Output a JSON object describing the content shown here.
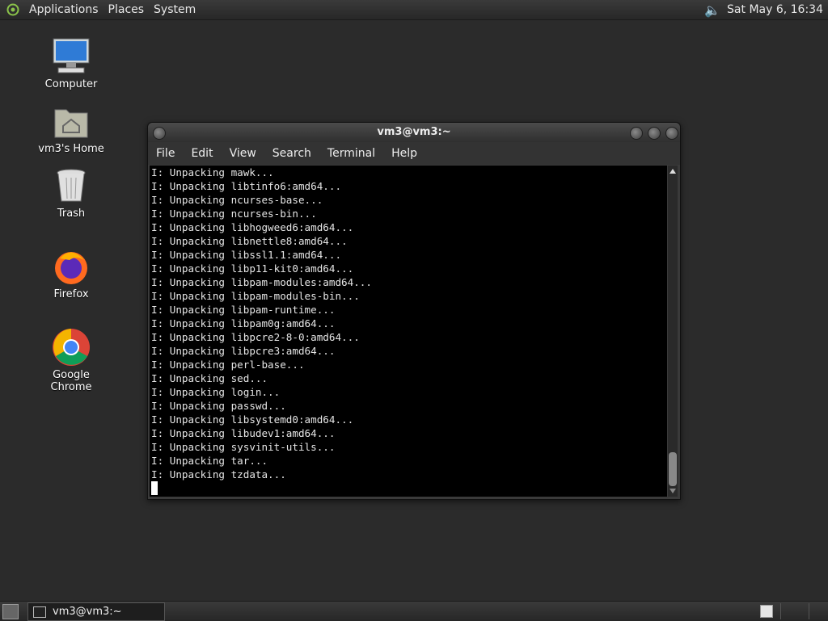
{
  "top_panel": {
    "menus": [
      "Applications",
      "Places",
      "System"
    ],
    "clock": "Sat May  6, 16:34"
  },
  "desktop_icons": [
    {
      "label": "Computer",
      "icon": "computer-icon"
    },
    {
      "label": "vm3's Home",
      "icon": "home-folder-icon"
    },
    {
      "label": "Trash",
      "icon": "trash-icon"
    },
    {
      "label": "Firefox",
      "icon": "firefox-icon"
    },
    {
      "label": "Google Chrome",
      "icon": "chrome-icon"
    }
  ],
  "terminal": {
    "title": "vm3@vm3:~",
    "menu": [
      "File",
      "Edit",
      "View",
      "Search",
      "Terminal",
      "Help"
    ],
    "lines": [
      "I: Unpacking mawk...",
      "I: Unpacking libtinfo6:amd64...",
      "I: Unpacking ncurses-base...",
      "I: Unpacking ncurses-bin...",
      "I: Unpacking libhogweed6:amd64...",
      "I: Unpacking libnettle8:amd64...",
      "I: Unpacking libssl1.1:amd64...",
      "I: Unpacking libp11-kit0:amd64...",
      "I: Unpacking libpam-modules:amd64...",
      "I: Unpacking libpam-modules-bin...",
      "I: Unpacking libpam-runtime...",
      "I: Unpacking libpam0g:amd64...",
      "I: Unpacking libpcre2-8-0:amd64...",
      "I: Unpacking libpcre3:amd64...",
      "I: Unpacking perl-base...",
      "I: Unpacking sed...",
      "I: Unpacking login...",
      "I: Unpacking passwd...",
      "I: Unpacking libsystemd0:amd64...",
      "I: Unpacking libudev1:amd64...",
      "I: Unpacking sysvinit-utils...",
      "I: Unpacking tar...",
      "I: Unpacking tzdata..."
    ]
  },
  "bottom_panel": {
    "task_label": "vm3@vm3:~"
  }
}
